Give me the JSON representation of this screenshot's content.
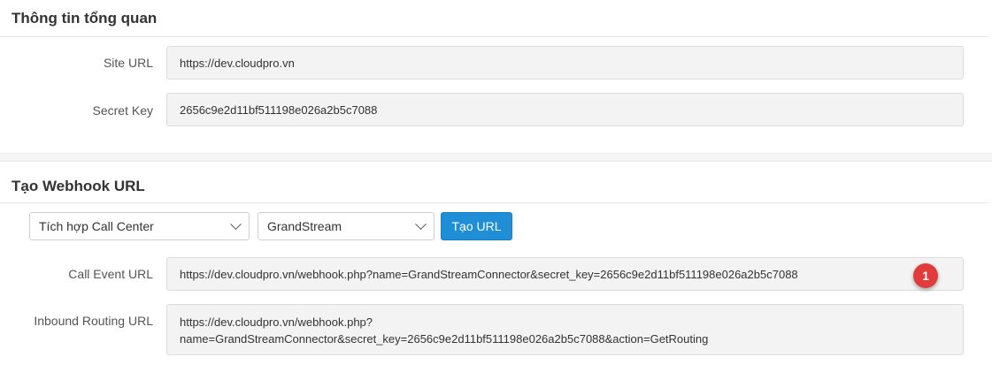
{
  "overview": {
    "title": "Thông tin tổng quan",
    "site_url_label": "Site URL",
    "site_url_value": "https://dev.cloudpro.vn",
    "secret_key_label": "Secret Key",
    "secret_key_value": "2656c9e2d11bf511198e026a2b5c7088"
  },
  "webhook": {
    "title": "Tạo Webhook URL",
    "integration_select": "Tích hợp Call Center",
    "provider_select": "GrandStream",
    "create_button": "Tạo URL",
    "call_event_label": "Call Event URL",
    "call_event_value": "https://dev.cloudpro.vn/webhook.php?name=GrandStreamConnector&secret_key=2656c9e2d11bf511198e026a2b5c7088",
    "inbound_label": "Inbound Routing URL",
    "inbound_value_line1": "https://dev.cloudpro.vn/webhook.php?",
    "inbound_value_line2": "name=GrandStreamConnector&secret_key=2656c9e2d11bf511198e026a2b5c7088&action=GetRouting",
    "badge": "1"
  },
  "colors": {
    "primary_button": "#1f8ed6",
    "badge": "#e23b3b",
    "field_bg": "#f3f3f3"
  }
}
